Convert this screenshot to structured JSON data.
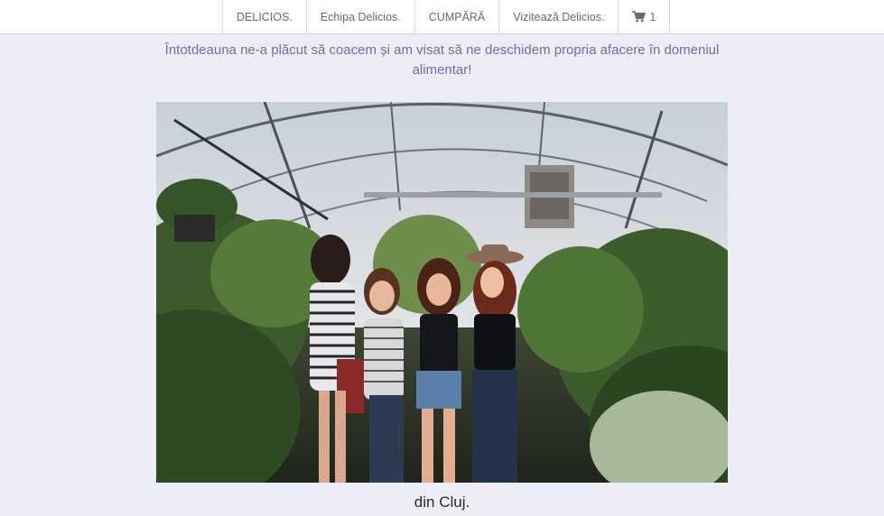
{
  "nav": {
    "items": [
      "DELICIOS.",
      "Echipa Delicios.",
      "CUMPĂRĂ",
      "Vizitează Delicios."
    ],
    "cart_count": "1",
    "cart_icon": "shopping-cart-icon"
  },
  "intro": "Întotdeauna ne-a plăcut să coacem și am visat să ne deschidem propria afacere în domeniul alimentar!",
  "caption": "din Cluj.",
  "colors": {
    "background": "#ededf7",
    "intro_text": "#7b68a8",
    "navbar": "#ffffff"
  }
}
